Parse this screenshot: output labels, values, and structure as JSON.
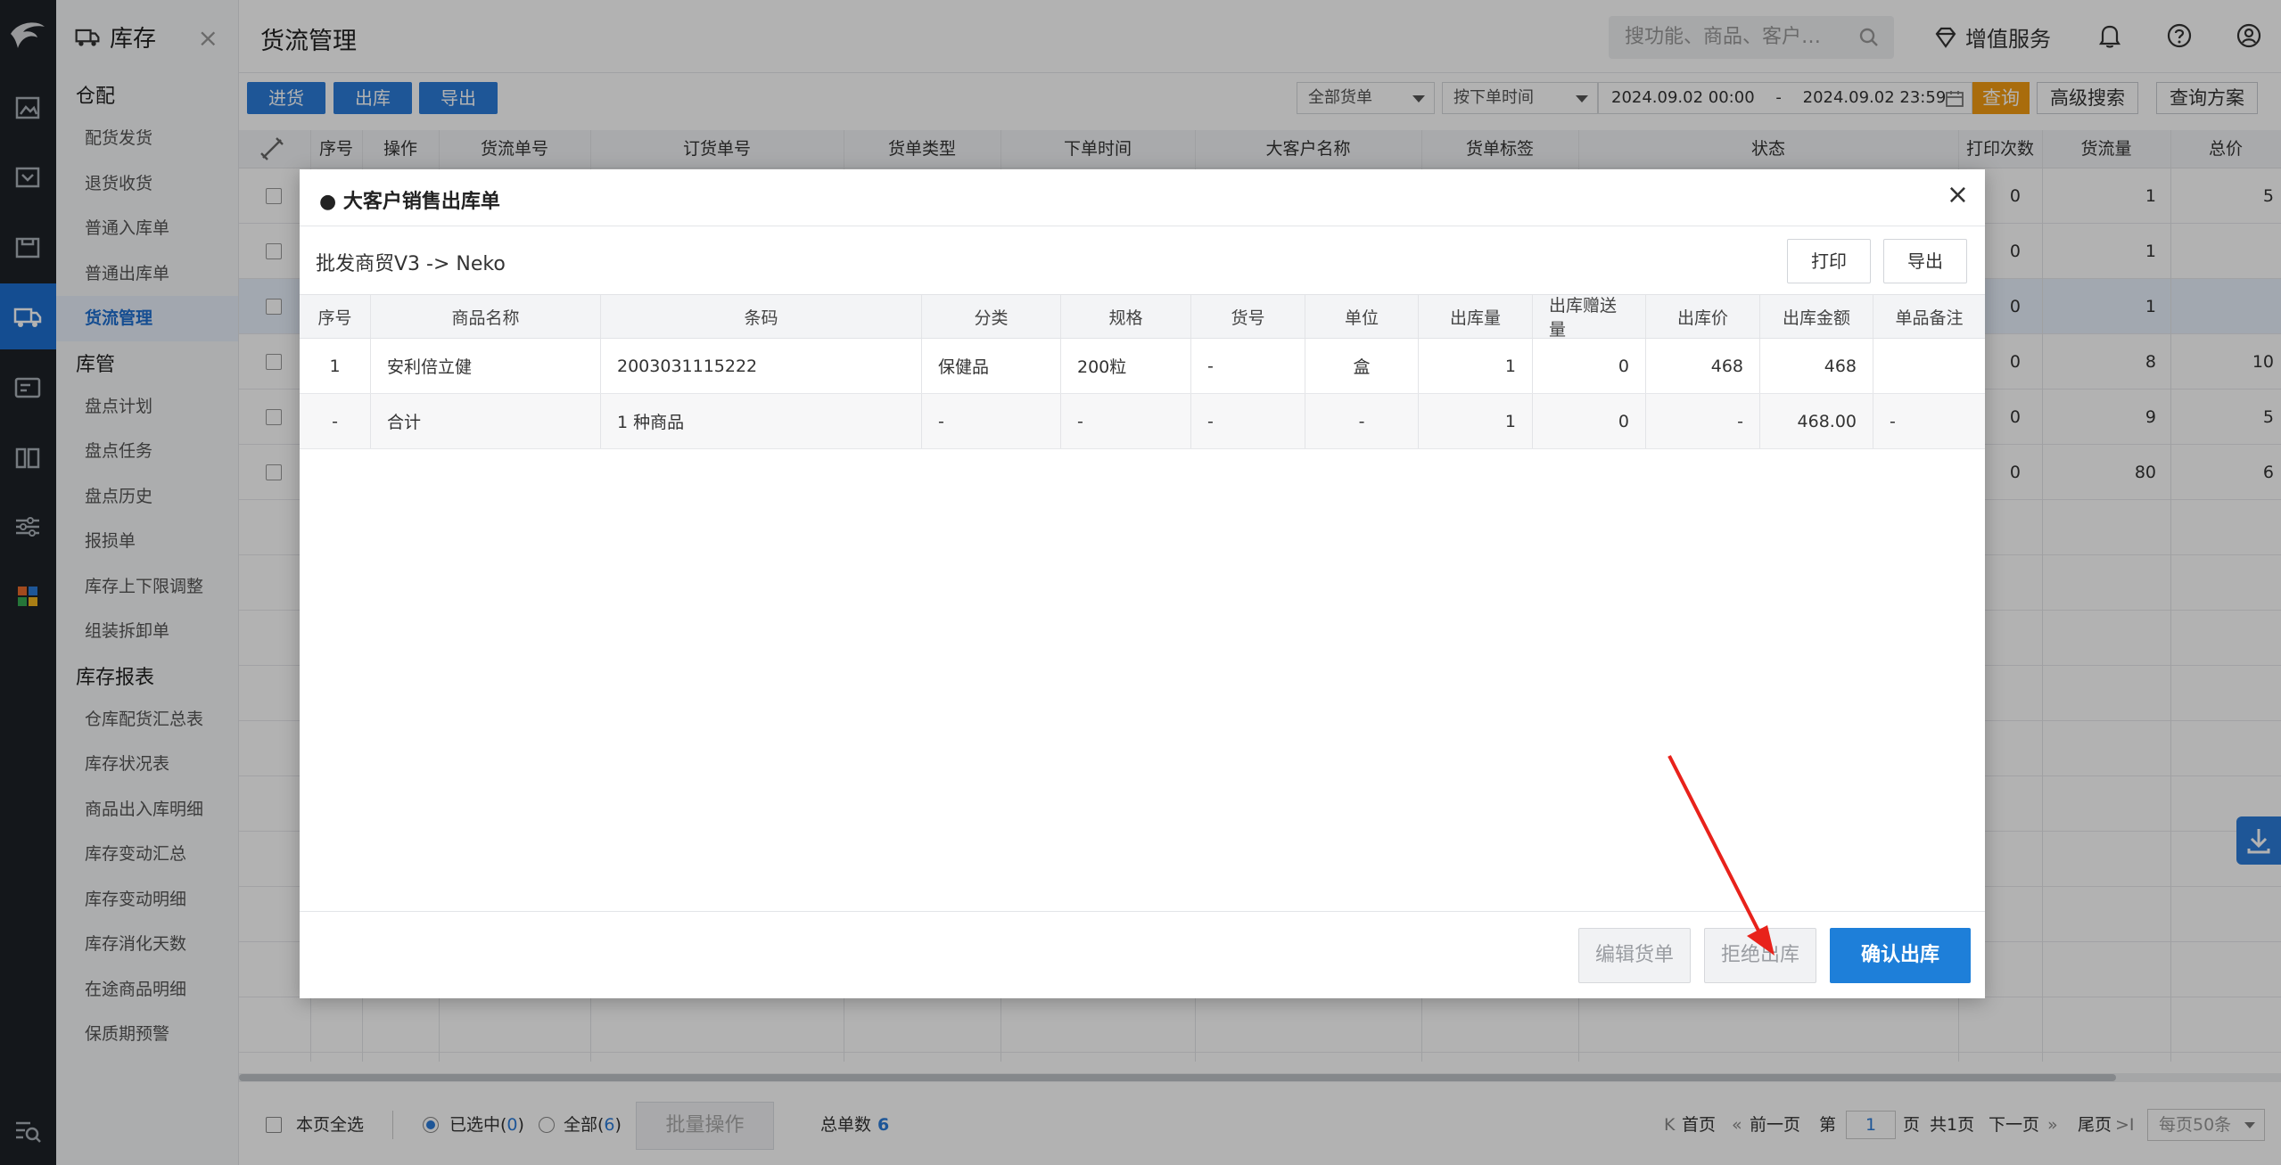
{
  "nav": {
    "module": "库存",
    "close": "×",
    "sections": [
      {
        "title": "仓配",
        "items": [
          "配货发货",
          "退货收货",
          "普通入库单",
          "普通出库单",
          "货流管理"
        ]
      },
      {
        "title": "库管",
        "items": [
          "盘点计划",
          "盘点任务",
          "盘点历史",
          "报损单",
          "库存上下限调整",
          "组装拆卸单"
        ]
      },
      {
        "title": "库存报表",
        "items": [
          "仓库配货汇总表",
          "库存状况表",
          "商品出入库明细",
          "库存变动汇总",
          "库存变动明细",
          "库存消化天数",
          "在途商品明细",
          "保质期预警"
        ]
      }
    ],
    "active_item": "货流管理"
  },
  "header": {
    "title": "货流管理",
    "search_placeholder": "搜功能、商品、客户…",
    "value_added": "增值服务"
  },
  "toolbar": {
    "in_label": "进货",
    "out_label": "出库",
    "export_label": "导出",
    "filter_all": "全部货单",
    "filter_time": "按下单时间",
    "date_from": "2024.09.02 00:00",
    "date_sep": "-",
    "date_to": "2024.09.02 23:59",
    "query_label": "查询",
    "advanced_label": "高级搜索",
    "scheme_label": "查询方案"
  },
  "bg_table": {
    "columns": [
      "序号",
      "操作",
      "货流单号",
      "订货单号",
      "货单类型",
      "下单时间",
      "大客户名称",
      "货单标签",
      "状态",
      "打印次数",
      "货流量",
      "总价"
    ],
    "rows": [
      {
        "print": "0",
        "flow": "1",
        "total": "5"
      },
      {
        "print": "0",
        "flow": "1",
        "total": ""
      },
      {
        "print": "0",
        "flow": "1",
        "total": ""
      },
      {
        "print": "0",
        "flow": "8",
        "total": "10"
      },
      {
        "print": "0",
        "flow": "9",
        "total": "5"
      },
      {
        "print": "0",
        "flow": "80",
        "total": "6"
      }
    ]
  },
  "footer": {
    "select_page": "本页全选",
    "selected_prefix": "已选中(",
    "selected_count": "0",
    "selected_suffix": ")",
    "all_prefix": "全部(",
    "all_count": "6",
    "all_suffix": ")",
    "batch": "批量操作",
    "total_label": "总单数",
    "total_value": "6",
    "first": "首页",
    "prev": "前一页",
    "page_prefix": "第",
    "page": "1",
    "page_suffix": "页",
    "page_total": "共1页",
    "next": "下一页",
    "last": "尾页",
    "per_page": "每页50条"
  },
  "modal": {
    "title": "大客户销售出库单",
    "close": "×",
    "route": "批发商贸V3 -> Neko",
    "print": "打印",
    "export": "导出",
    "columns": [
      "序号",
      "商品名称",
      "条码",
      "分类",
      "规格",
      "货号",
      "单位",
      "出库量",
      "出库赠送量",
      "出库价",
      "出库金额",
      "单品备注"
    ],
    "rows": [
      [
        "1",
        "安利倍立健",
        "2003031115222",
        "保健品",
        "200粒",
        "-",
        "盒",
        "1",
        "0",
        "468",
        "468",
        ""
      ],
      [
        "-",
        "合计",
        "1 种商品",
        "-",
        "-",
        "-",
        "-",
        "1",
        "0",
        "-",
        "468.00",
        "-"
      ]
    ],
    "edit": "编辑货单",
    "reject": "拒绝出库",
    "confirm": "确认出库"
  },
  "colors": {
    "primary": "#1e7fd9",
    "accent_orange": "#f39b12",
    "rail_bg": "#1e2227",
    "annotation_arrow": "#e8221b"
  }
}
